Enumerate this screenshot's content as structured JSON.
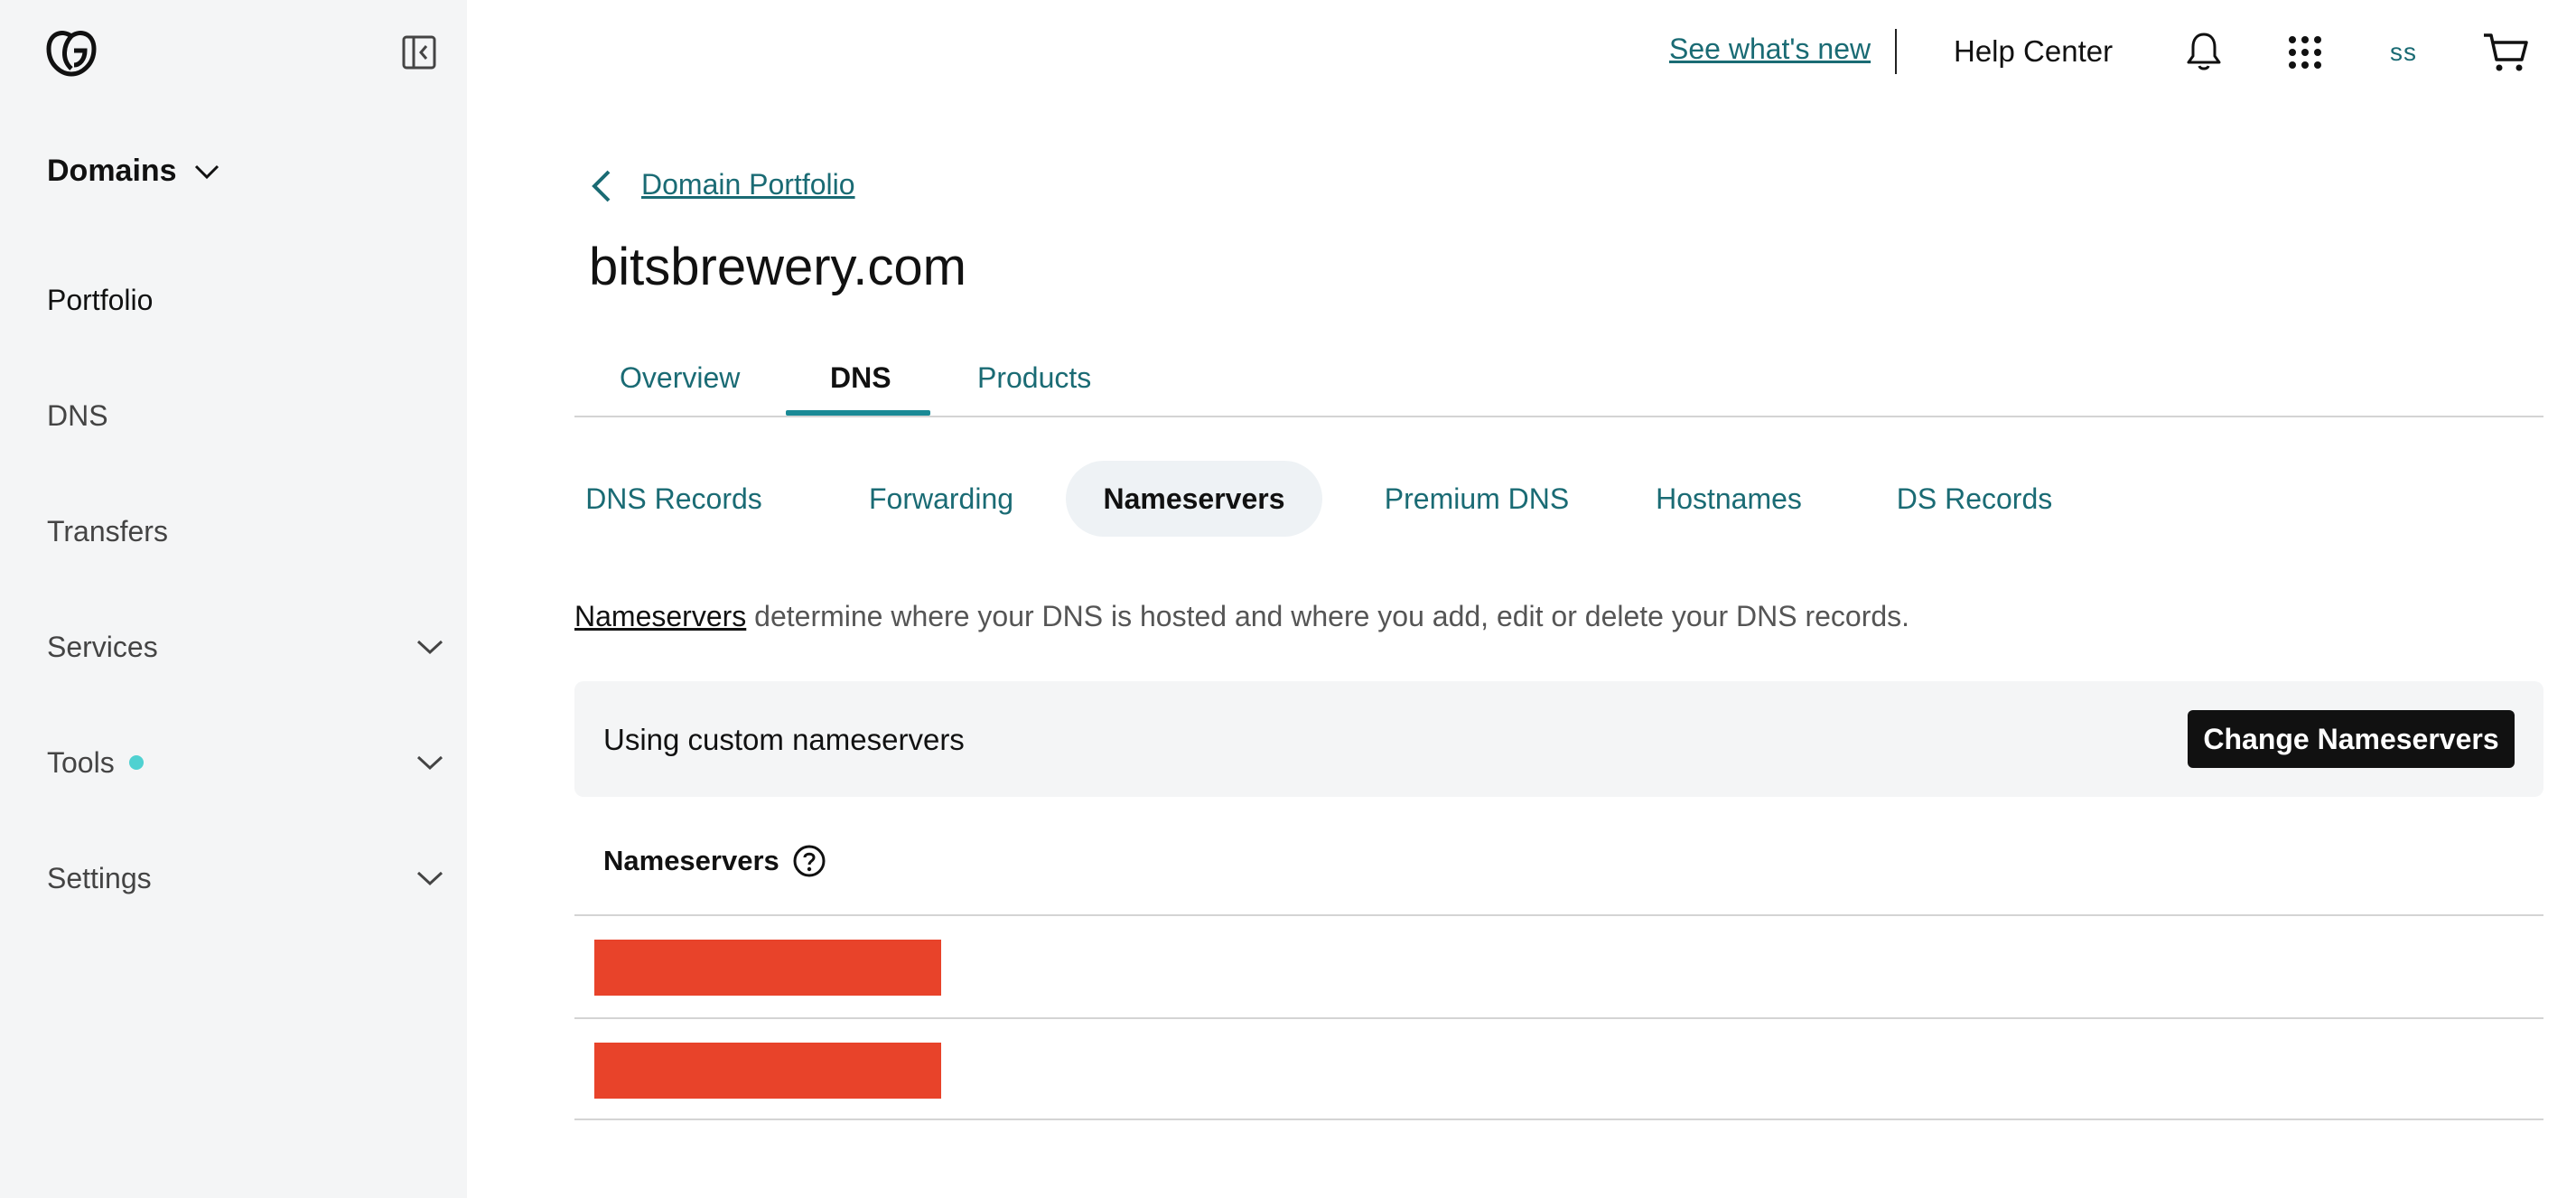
{
  "sidebar": {
    "section": "Domains",
    "items": [
      {
        "label": "Portfolio",
        "expandable": false,
        "active": true
      },
      {
        "label": "DNS",
        "expandable": false
      },
      {
        "label": "Transfers",
        "expandable": false
      },
      {
        "label": "Services",
        "expandable": true
      },
      {
        "label": "Tools",
        "expandable": true,
        "badge": "new-dot"
      },
      {
        "label": "Settings",
        "expandable": true
      }
    ]
  },
  "header": {
    "whats_new": "See what's new",
    "help": "Help Center",
    "avatar_initials": "ss",
    "icons": [
      "bell-icon",
      "apps-grid-icon",
      "cart-icon"
    ]
  },
  "breadcrumb": {
    "label": "Domain Portfolio"
  },
  "page_title": "bitsbrewery.com",
  "tabs": [
    {
      "label": "Overview"
    },
    {
      "label": "DNS",
      "active": true
    },
    {
      "label": "Products"
    }
  ],
  "subtabs": [
    {
      "label": "DNS Records"
    },
    {
      "label": "Forwarding"
    },
    {
      "label": "Nameservers",
      "active": true
    },
    {
      "label": "Premium DNS"
    },
    {
      "label": "Hostnames"
    },
    {
      "label": "DS Records"
    }
  ],
  "description": {
    "link": "Nameservers",
    "text": " determine where your DNS is hosted and where you add, edit or delete your DNS records."
  },
  "banner": {
    "text": "Using custom nameservers",
    "button": "Change Nameservers"
  },
  "nameservers": {
    "header": "Nameservers",
    "rows": [
      {
        "value": "[redacted]"
      },
      {
        "value": "[redacted]"
      }
    ]
  },
  "colors": {
    "accent": "#1a6b74",
    "redaction": "#e8432a",
    "sidebar_bg": "#f4f5f6",
    "tools_badge": "#4fd1d1"
  }
}
